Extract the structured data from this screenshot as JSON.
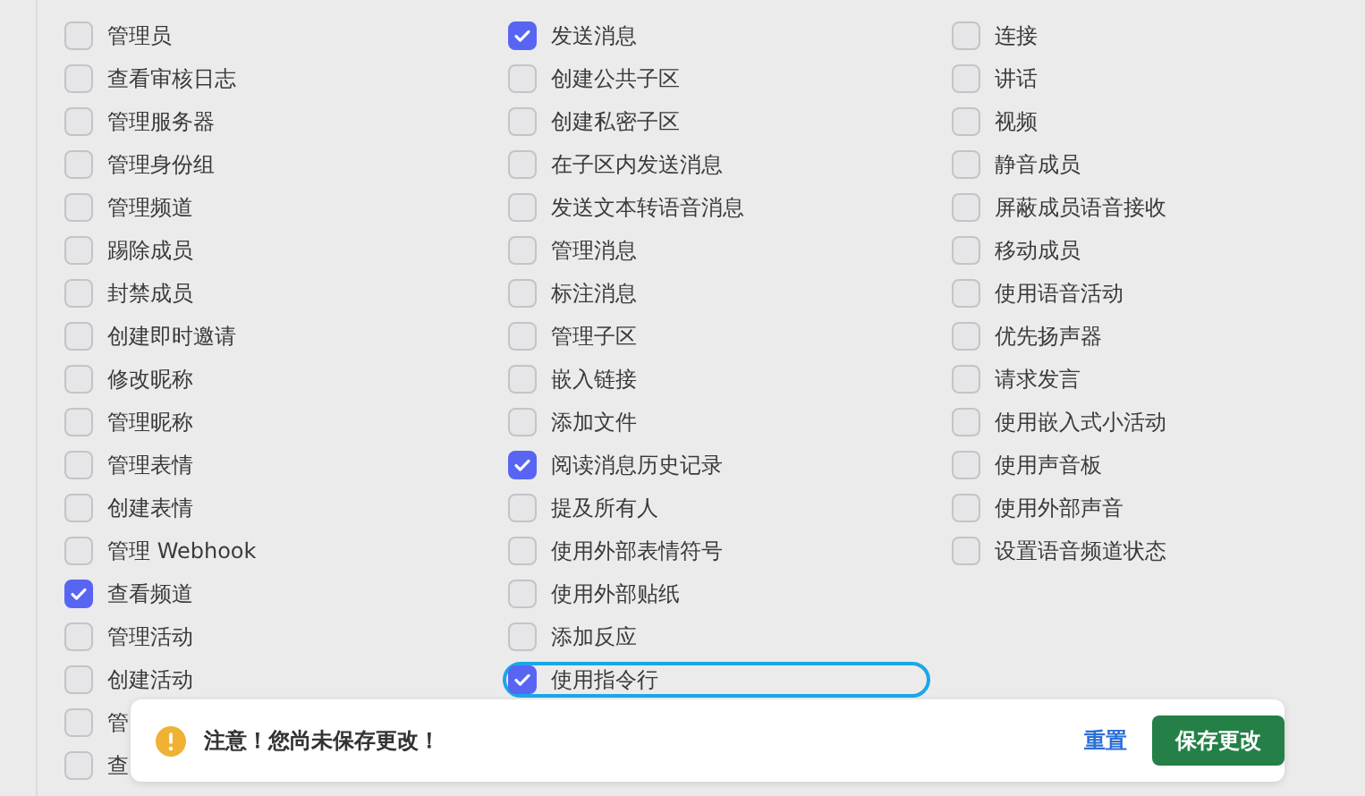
{
  "columns": [
    {
      "items": [
        {
          "label": "管理员",
          "checked": false,
          "focused": false
        },
        {
          "label": "查看审核日志",
          "checked": false,
          "focused": false
        },
        {
          "label": "管理服务器",
          "checked": false,
          "focused": false
        },
        {
          "label": "管理身份组",
          "checked": false,
          "focused": false
        },
        {
          "label": "管理频道",
          "checked": false,
          "focused": false
        },
        {
          "label": "踢除成员",
          "checked": false,
          "focused": false
        },
        {
          "label": "封禁成员",
          "checked": false,
          "focused": false
        },
        {
          "label": "创建即时邀请",
          "checked": false,
          "focused": false
        },
        {
          "label": "修改昵称",
          "checked": false,
          "focused": false
        },
        {
          "label": "管理昵称",
          "checked": false,
          "focused": false
        },
        {
          "label": "管理表情",
          "checked": false,
          "focused": false
        },
        {
          "label": "创建表情",
          "checked": false,
          "focused": false
        },
        {
          "label": "管理 Webhook",
          "checked": false,
          "focused": false
        },
        {
          "label": "查看频道",
          "checked": true,
          "focused": false
        },
        {
          "label": "管理活动",
          "checked": false,
          "focused": false
        },
        {
          "label": "创建活动",
          "checked": false,
          "focused": false
        },
        {
          "label": "管",
          "checked": false,
          "focused": false
        },
        {
          "label": "查",
          "checked": false,
          "focused": false
        }
      ]
    },
    {
      "items": [
        {
          "label": "发送消息",
          "checked": true,
          "focused": false
        },
        {
          "label": "创建公共子区",
          "checked": false,
          "focused": false
        },
        {
          "label": "创建私密子区",
          "checked": false,
          "focused": false
        },
        {
          "label": "在子区内发送消息",
          "checked": false,
          "focused": false
        },
        {
          "label": "发送文本转语音消息",
          "checked": false,
          "focused": false
        },
        {
          "label": "管理消息",
          "checked": false,
          "focused": false
        },
        {
          "label": "标注消息",
          "checked": false,
          "focused": false
        },
        {
          "label": "管理子区",
          "checked": false,
          "focused": false
        },
        {
          "label": "嵌入链接",
          "checked": false,
          "focused": false
        },
        {
          "label": "添加文件",
          "checked": false,
          "focused": false
        },
        {
          "label": "阅读消息历史记录",
          "checked": true,
          "focused": false
        },
        {
          "label": "提及所有人",
          "checked": false,
          "focused": false
        },
        {
          "label": "使用外部表情符号",
          "checked": false,
          "focused": false
        },
        {
          "label": "使用外部贴纸",
          "checked": false,
          "focused": false
        },
        {
          "label": "添加反应",
          "checked": false,
          "focused": false
        },
        {
          "label": "使用指令行",
          "checked": true,
          "focused": true
        }
      ]
    },
    {
      "items": [
        {
          "label": "连接",
          "checked": false,
          "focused": false
        },
        {
          "label": "讲话",
          "checked": false,
          "focused": false
        },
        {
          "label": "视频",
          "checked": false,
          "focused": false
        },
        {
          "label": "静音成员",
          "checked": false,
          "focused": false
        },
        {
          "label": "屏蔽成员语音接收",
          "checked": false,
          "focused": false
        },
        {
          "label": "移动成员",
          "checked": false,
          "focused": false
        },
        {
          "label": "使用语音活动",
          "checked": false,
          "focused": false
        },
        {
          "label": "优先扬声器",
          "checked": false,
          "focused": false
        },
        {
          "label": "请求发言",
          "checked": false,
          "focused": false
        },
        {
          "label": "使用嵌入式小活动",
          "checked": false,
          "focused": false
        },
        {
          "label": "使用声音板",
          "checked": false,
          "focused": false
        },
        {
          "label": "使用外部声音",
          "checked": false,
          "focused": false
        },
        {
          "label": "设置语音频道状态",
          "checked": false,
          "focused": false
        }
      ]
    }
  ],
  "notice": {
    "message": "注意！您尚未保存更改！",
    "reset": "重置",
    "save": "保存更改"
  }
}
